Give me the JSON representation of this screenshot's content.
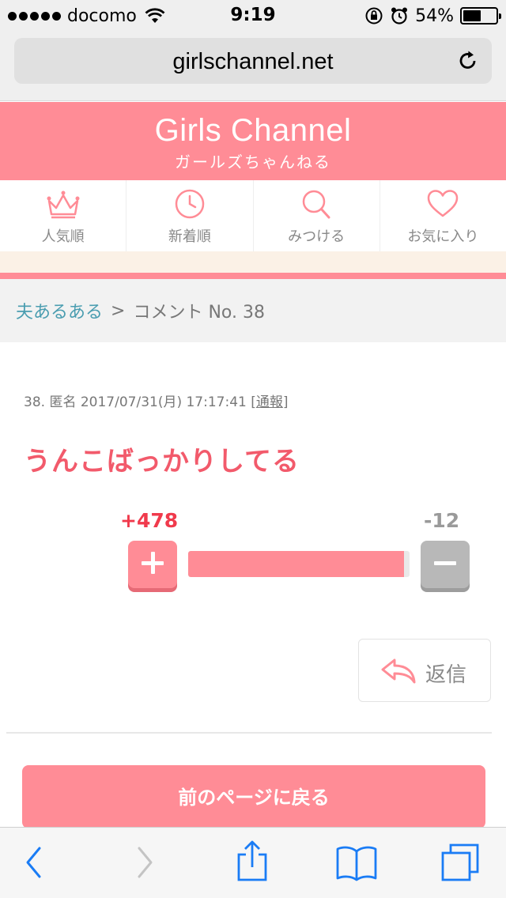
{
  "status_bar": {
    "carrier": "docomo",
    "time": "9:19",
    "battery": "54%",
    "battery_level": 0.54
  },
  "browser": {
    "url": "girlschannel.net"
  },
  "header": {
    "logo_title": "Girls Channel",
    "logo_subtitle": "ガールズちゃんねる"
  },
  "nav": {
    "items": [
      {
        "label": "人気順",
        "icon": "crown-icon"
      },
      {
        "label": "新着順",
        "icon": "clock-icon"
      },
      {
        "label": "みつける",
        "icon": "search-icon"
      },
      {
        "label": "お気に入り",
        "icon": "heart-icon"
      }
    ]
  },
  "breadcrumb": {
    "link": "夫あるある",
    "separator": ">",
    "current": "コメント No. 38"
  },
  "comment": {
    "meta": "38. 匿名 2017/07/31(月) 17:17:41 [",
    "report": "通報",
    "meta_end": "]",
    "body": "うんこばっかりしてる",
    "plus_count": "+478",
    "minus_count": "-12",
    "plus_value": 478,
    "minus_value": 12
  },
  "actions": {
    "reply_label": "返信",
    "back_label": "前のページに戻る"
  },
  "colors": {
    "brand_pink": "#ff8c96",
    "plus_red": "#f03a4c",
    "link_teal": "#4a9db0",
    "ios_blue": "#1a7cf5"
  }
}
